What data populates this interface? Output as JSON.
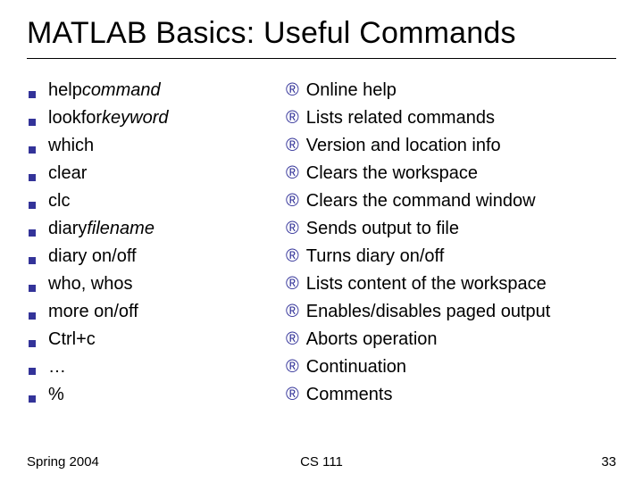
{
  "title": "MATLAB Basics: Useful Commands",
  "items": [
    {
      "cmd": "help ",
      "arg": "command",
      "desc": "Online help"
    },
    {
      "cmd": "lookfor ",
      "arg": "keyword",
      "desc": "Lists related commands"
    },
    {
      "cmd": "which",
      "arg": "",
      "desc": "Version and location info"
    },
    {
      "cmd": "clear",
      "arg": "",
      "desc": "Clears the workspace"
    },
    {
      "cmd": "clc",
      "arg": "",
      "desc": "Clears the command window"
    },
    {
      "cmd": "diary ",
      "arg": "filename",
      "desc": "Sends output to file"
    },
    {
      "cmd": "diary on/off",
      "arg": "",
      "desc": "Turns diary on/off"
    },
    {
      "cmd": "who, whos",
      "arg": "",
      "desc": "Lists content of the workspace"
    },
    {
      "cmd": "more on/off",
      "arg": "",
      "desc": "Enables/disables paged output"
    },
    {
      "cmd": "Ctrl+c",
      "arg": "",
      "desc": "Aborts operation"
    },
    {
      "cmd": "…",
      "arg": "",
      "desc": "Continuation"
    },
    {
      "cmd": "%",
      "arg": "",
      "desc": "Comments"
    }
  ],
  "footer": {
    "left": "Spring 2004",
    "center": "CS 111",
    "right": "33"
  }
}
